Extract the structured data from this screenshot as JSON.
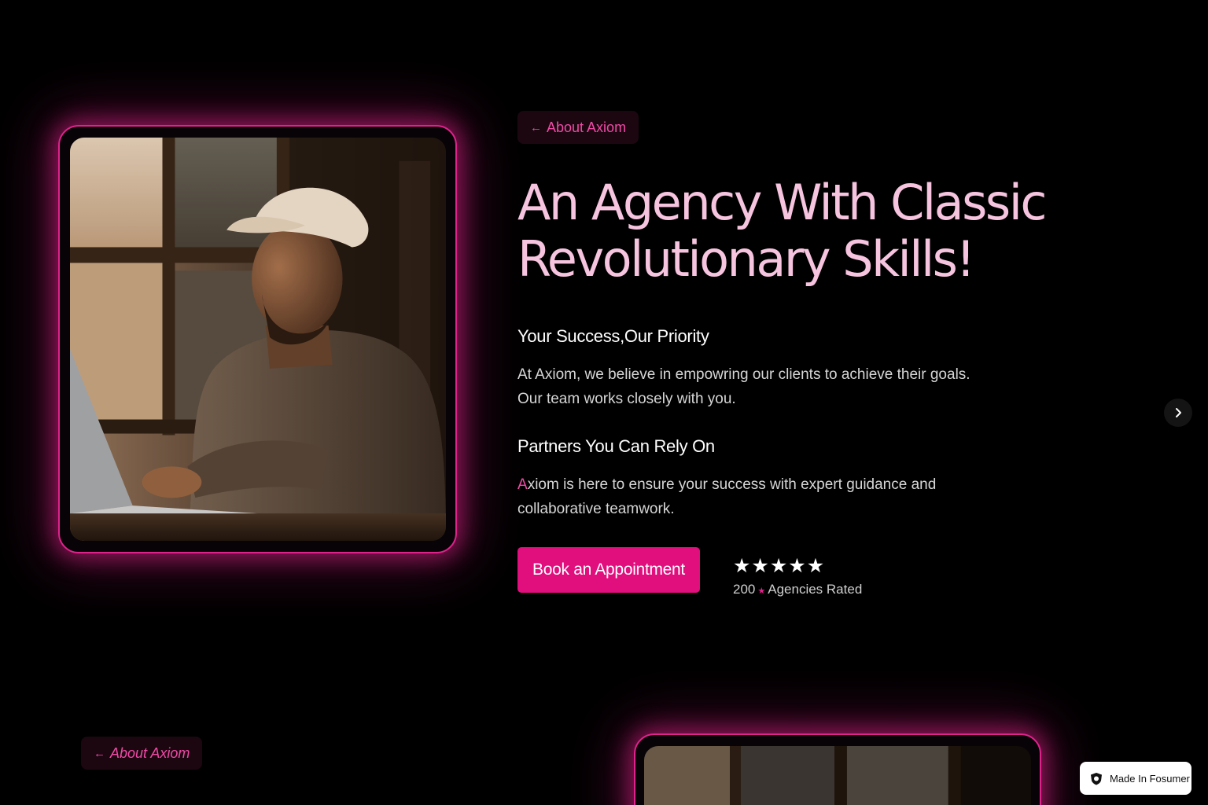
{
  "hero": {
    "badge_label": "About Axiom",
    "headline_line1": "An Agency With Classic",
    "headline_line2": "Revolutionary Skills!",
    "sections": [
      {
        "heading": "Your Success,Our Priority",
        "lines": [
          "At  Axiom, we believe in empowring our clients to achieve their goals.",
          "Our team works closely with you."
        ]
      },
      {
        "heading": "Partners You Can Rely On",
        "first_letter": "A",
        "lines": [
          "xiom is here to ensure your success with expert guidance and",
          "collaborative teamwork."
        ]
      }
    ],
    "cta_label": "Book an Appointment",
    "rating": {
      "stars": [
        "★",
        "★",
        "★",
        "★",
        "★"
      ],
      "count": "200",
      "small_star": "★",
      "label": "Agencies Rated",
      "value": 5
    }
  },
  "next_section": {
    "badge_label": "About Axiom"
  },
  "icons": {
    "back_arrow": "←",
    "next_chevron": "chevron-right-icon",
    "badge_logo": "shield-logo-icon"
  },
  "made_in_badge": {
    "label": "Made In Fosumer"
  },
  "colors": {
    "background": "#000000",
    "accent": "#e10e7d",
    "headline": "#f6c4df",
    "glow": "#e0228d"
  }
}
